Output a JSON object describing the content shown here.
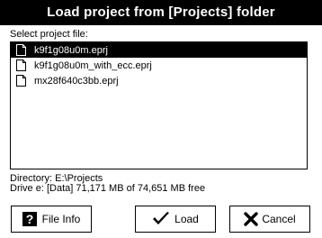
{
  "window": {
    "title": "Load project from [Projects] folder"
  },
  "file_list": {
    "label": "Select project file:",
    "items": [
      {
        "name": "k9f1g08u0m.eprj",
        "selected": true
      },
      {
        "name": "k9f1g08u0m_with_ecc.eprj",
        "selected": false
      },
      {
        "name": "mx28f640c3bb.eprj",
        "selected": false
      }
    ]
  },
  "info": {
    "directory": "Directory: E:\\Projects",
    "drive": "Drive e: [Data]  71,171 MB of 74,651 MB free"
  },
  "buttons": {
    "file_info": {
      "label": "File Info",
      "icon": "question-mark-icon"
    },
    "load": {
      "label": "Load",
      "icon": "checkmark-icon"
    },
    "cancel": {
      "label": "Cancel",
      "icon": "x-icon"
    }
  },
  "colors": {
    "title_bg": "#000000",
    "title_fg": "#ffffff",
    "selection_bg": "#000000",
    "selection_fg": "#ffffff"
  }
}
